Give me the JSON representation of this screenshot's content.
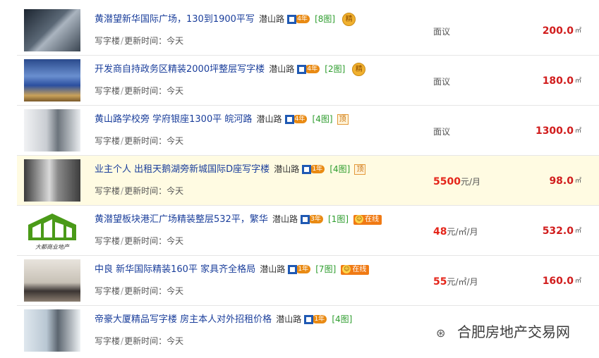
{
  "listings": [
    {
      "title": "黄潜望新华国际广场，130到1900平写",
      "road": "潜山路",
      "years": "4年",
      "pics": "[8图]",
      "tag": "jing",
      "tag_text": "精",
      "category": "写字楼",
      "updated_label": "更新时间：",
      "updated": "今天",
      "price_num": "",
      "price_text": "面议",
      "price_unit": "",
      "area": "200.0",
      "area_unit": "㎡"
    },
    {
      "title": "开发商自持政务区精装2000坪整层写字楼",
      "road": "潜山路",
      "years": "4年",
      "pics": "[2图]",
      "tag": "jing",
      "tag_text": "精",
      "category": "写字楼",
      "updated_label": "更新时间：",
      "updated": "今天",
      "price_num": "",
      "price_text": "面议",
      "price_unit": "",
      "area": "180.0",
      "area_unit": "㎡"
    },
    {
      "title": "黄山路学校旁 学府银座1300平 皖河路",
      "road": "潜山路",
      "years": "4年",
      "pics": "[4图]",
      "tag": "ding",
      "tag_text": "顶",
      "category": "写字楼",
      "updated_label": "更新时间：",
      "updated": "今天",
      "price_num": "",
      "price_text": "面议",
      "price_unit": "",
      "area": "1300.0",
      "area_unit": "㎡"
    },
    {
      "title": "业主个人 出租天鹅湖旁新城国际D座写字楼",
      "road": "潜山路",
      "years": "1年",
      "pics": "[4图]",
      "tag": "ding",
      "tag_text": "顶",
      "category": "写字楼",
      "updated_label": "更新时间：",
      "updated": "今天",
      "price_num": "5500",
      "price_text": "",
      "price_unit": "元/月",
      "area": "98.0",
      "area_unit": "㎡",
      "highlight": true
    },
    {
      "title": "黄潜望板块港汇广场精装整层532平，繁华",
      "road": "潜山路",
      "years": "3年",
      "pics": "[1图]",
      "tag": "online",
      "tag_text": "在线",
      "category": "写字楼",
      "updated_label": "更新时间：",
      "updated": "今天",
      "price_num": "48",
      "price_text": "",
      "price_unit": "元/㎡/月",
      "area": "532.0",
      "area_unit": "㎡",
      "logo_caption": "大都商业地产"
    },
    {
      "title": "中良 新华国际精装160平 家具齐全格局",
      "road": "潜山路",
      "years": "1年",
      "pics": "[7图]",
      "tag": "online",
      "tag_text": "在线",
      "category": "写字楼",
      "updated_label": "更新时间：",
      "updated": "今天",
      "price_num": "55",
      "price_text": "",
      "price_unit": "元/㎡/月",
      "area": "160.0",
      "area_unit": "㎡"
    },
    {
      "title": "帝豪大厦精品写字楼 房主本人对外招租价格",
      "road": "潜山路",
      "years": "1年",
      "pics": "[4图]",
      "tag": "",
      "tag_text": "",
      "category": "写字楼",
      "updated_label": "更新时间：",
      "updated": "今天",
      "price_num": "",
      "price_text": "",
      "price_unit": "",
      "area": "",
      "area_unit": ""
    }
  ],
  "watermark": "合肥房地产交易网",
  "icons": {
    "year_badge": "company-year-icon",
    "jing": "jing-medal-icon",
    "ding": "ding-top-icon",
    "online": "online-chat-icon"
  }
}
